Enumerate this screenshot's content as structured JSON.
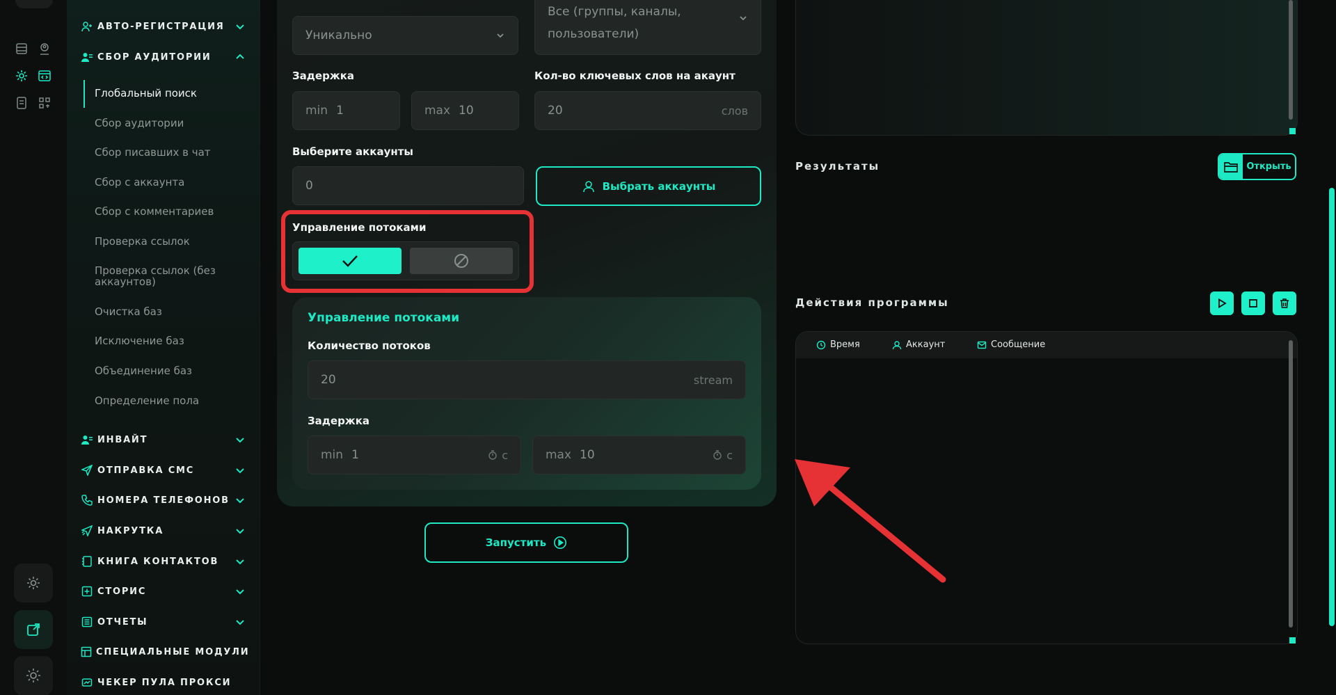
{
  "sidebar": {
    "sections_top": [
      {
        "label": "Авто-регистрация",
        "icon": "user-plus-icon",
        "expanded": false
      },
      {
        "label": "Сбор аудитории",
        "icon": "users-icon",
        "expanded": true
      }
    ],
    "sub_items": [
      {
        "label": "Глобальный поиск",
        "active": true
      },
      {
        "label": "Сбор аудитории"
      },
      {
        "label": "Сбор писавших в чат"
      },
      {
        "label": "Сбор с аккаунта"
      },
      {
        "label": "Сбор с комментариев"
      },
      {
        "label": "Проверка ссылок"
      },
      {
        "label": "Проверка ссылок (без аккаунтов)"
      },
      {
        "label": "Очистка баз"
      },
      {
        "label": "Исключение баз"
      },
      {
        "label": "Объединение баз"
      },
      {
        "label": "Определение пола"
      }
    ],
    "sections_bottom": [
      {
        "label": "Инвайт",
        "icon": "users-icon"
      },
      {
        "label": "Отправка смс",
        "icon": "send-icon"
      },
      {
        "label": "Номера телефонов",
        "icon": "phone-icon"
      },
      {
        "label": "Накрутка",
        "icon": "boost-icon"
      },
      {
        "label": "Книга контактов",
        "icon": "book-icon"
      },
      {
        "label": "Сторис",
        "icon": "plus-square-icon"
      },
      {
        "label": "Отчеты",
        "icon": "report-icon"
      },
      {
        "label": "Специальные модули",
        "icon": "modules-icon"
      },
      {
        "label": "Чекер пула прокси",
        "icon": "proxy-icon"
      }
    ]
  },
  "form": {
    "mode_select": "Уникально",
    "target_select": "Все (группы, каналы, пользователи)",
    "delay_label": "Задержка",
    "delay_min_prefix": "min",
    "delay_min": "1",
    "delay_max_prefix": "max",
    "delay_max": "10",
    "keywords_label": "Кол-во ключевых слов на акаунт",
    "keywords_value": "20",
    "keywords_suffix": "слов",
    "accounts_label": "Выберите аккаунты",
    "accounts_value": "0",
    "choose_accounts_button": "Выбрать аккаунты",
    "threads_toggle_label": "Управление потоками",
    "threads_enabled": true,
    "threads_card_title": "Управление потоками",
    "threads_count_label": "Количество потоков",
    "threads_count_value": "20",
    "threads_count_suffix": "stream",
    "threads_delay_label": "Задержка",
    "threads_delay_min_prefix": "min",
    "threads_delay_min": "1",
    "threads_delay_max_prefix": "max",
    "threads_delay_max": "10",
    "seconds_suffix": "с",
    "start_button": "Запустить"
  },
  "right": {
    "results_title": "Результаты",
    "open_button": "Открыть",
    "actions_title": "Действия программы",
    "columns": [
      {
        "label": "Время",
        "icon": "clock-icon"
      },
      {
        "label": "Аккаунт",
        "icon": "user-icon"
      },
      {
        "label": "Сообщение",
        "icon": "mail-icon"
      }
    ]
  },
  "colors": {
    "accent": "#1de9c4",
    "highlight_red": "#e63234"
  }
}
